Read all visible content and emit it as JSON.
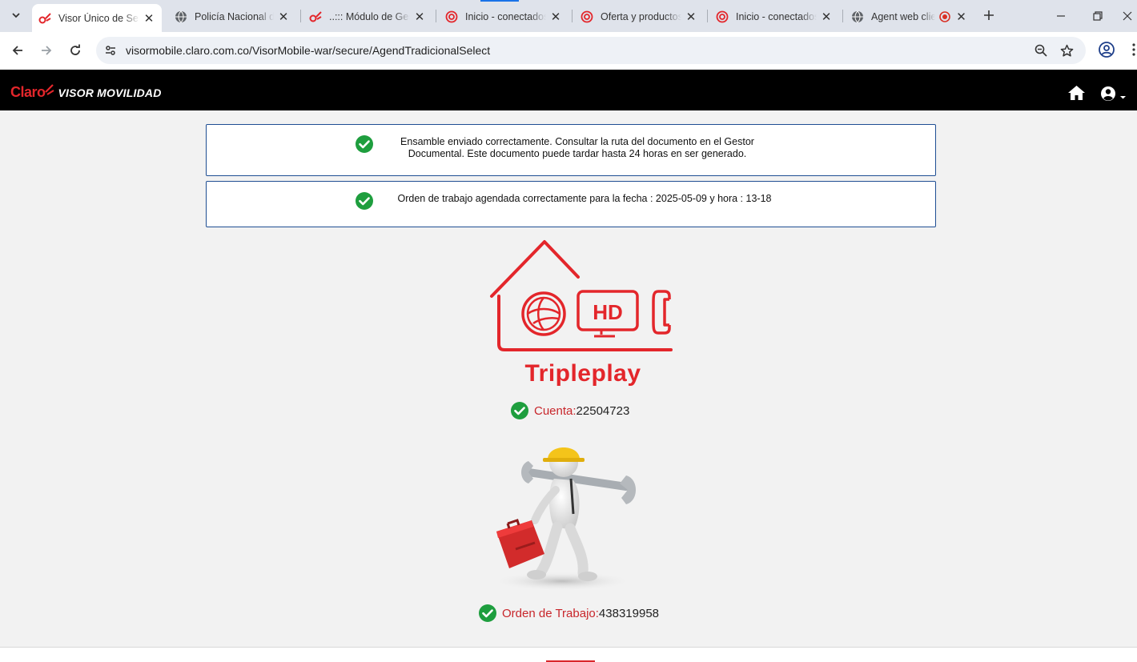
{
  "browser": {
    "tabs": [
      {
        "title": "Visor Único de Servicios",
        "icon": "claro-logo-icon",
        "active": true
      },
      {
        "title": "Policía Nacional de Colombia",
        "icon": "globe-icon"
      },
      {
        "title": "..::: Módulo de Gestión",
        "icon": "claro-logo-icon"
      },
      {
        "title": "Inicio - conectados",
        "icon": "claro-circle-icon"
      },
      {
        "title": "Oferta y productos",
        "icon": "claro-circle-icon"
      },
      {
        "title": "Inicio - conectados",
        "icon": "claro-circle-icon"
      },
      {
        "title": "Agent web client",
        "icon": "globe-icon",
        "recording": true
      }
    ],
    "url": "visormobile.claro.com.co/VisorMobile-war/secure/AgendTradicionalSelect"
  },
  "app": {
    "logo_brand": "Claro",
    "logo_product": "VISOR MOVILIDAD"
  },
  "alerts": [
    {
      "line1": "Ensamble enviado correctamente. Consultar la ruta del documento en el Gestor",
      "line2": "Documental. Este documento puede tardar hasta 24 horas en ser generado."
    },
    {
      "line1": "Orden de trabajo agendada correctamente para la fecha : 2025-05-09 y hora : 13-18",
      "line2": ""
    }
  ],
  "service": {
    "name": "Tripleplay",
    "hd_label": "HD"
  },
  "account": {
    "label": "Cuenta:",
    "value": "22504723"
  },
  "work_order": {
    "label": "Orden de Trabajo:",
    "value": "438319958"
  },
  "colors": {
    "brand_red": "#e3262b",
    "success_green": "#1e9e3e",
    "alert_border": "#1f4e93",
    "appbar_bg": "#000000"
  }
}
